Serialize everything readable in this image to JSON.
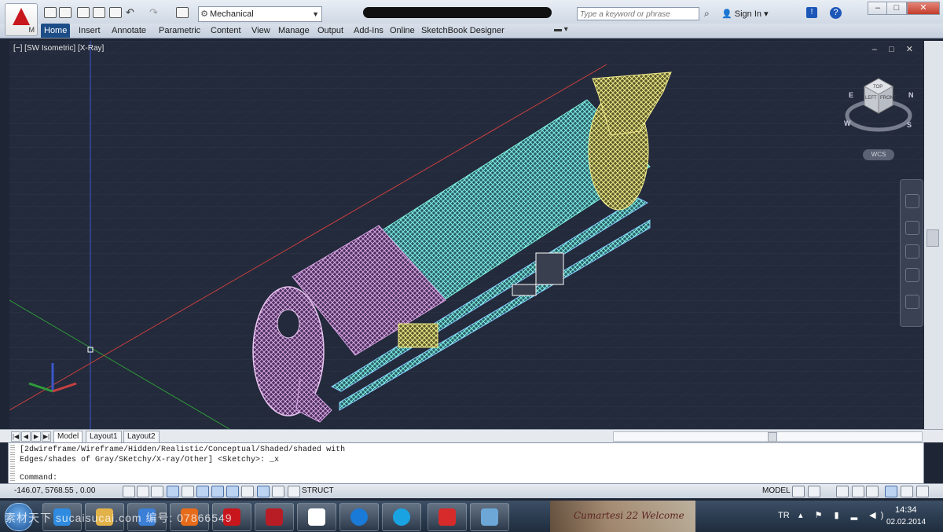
{
  "app": {
    "workspace": "Mechanical",
    "search_placeholder": "Type a keyword or phrase",
    "sign_in": "Sign In",
    "app_menu_letter": "M"
  },
  "ribbon": {
    "tabs": [
      "Home",
      "Insert",
      "Annotate",
      "Parametric",
      "Content",
      "View",
      "Manage",
      "Output",
      "Add-Ins",
      "Online",
      "SketchBook Designer"
    ],
    "active": "Home"
  },
  "viewport": {
    "label": "[−] [SW Isometric] [X-Ray]",
    "controls": "– □ ✕",
    "viewcube": {
      "top": "TOP",
      "left": "LEFT",
      "front": "FRONT",
      "compass": [
        "N",
        "W",
        "S",
        "E"
      ]
    },
    "wcs": "WCS"
  },
  "layout_tabs": [
    "Model",
    "Layout1",
    "Layout2"
  ],
  "command": {
    "history": "[2dwireframe/Wireframe/Hidden/Realistic/Conceptual/Shaded/shaded with\nEdges/shades of Gray/SKetchy/X-ray/Other] <Sketchy>: _x",
    "prompt": "Command:"
  },
  "status": {
    "coords": "-146.07, 5768.55 , 0.00",
    "struct": "STRUCT",
    "model": "MODEL"
  },
  "taskbar": {
    "watermark": "素材天下 sucaisucai.com  编号: 07866549",
    "tray_lang": "TR",
    "time": "14:34",
    "date": "02.02.2014",
    "ad_text": "Cumartesi 22 Welcome"
  },
  "colors": {
    "viewport_bg": "#232a3b",
    "wire_cyan": "#5fe0d0",
    "wire_purple": "#c58fd0",
    "wire_yellow": "#e8e37a",
    "ribbon_active": "#1d4d86"
  }
}
